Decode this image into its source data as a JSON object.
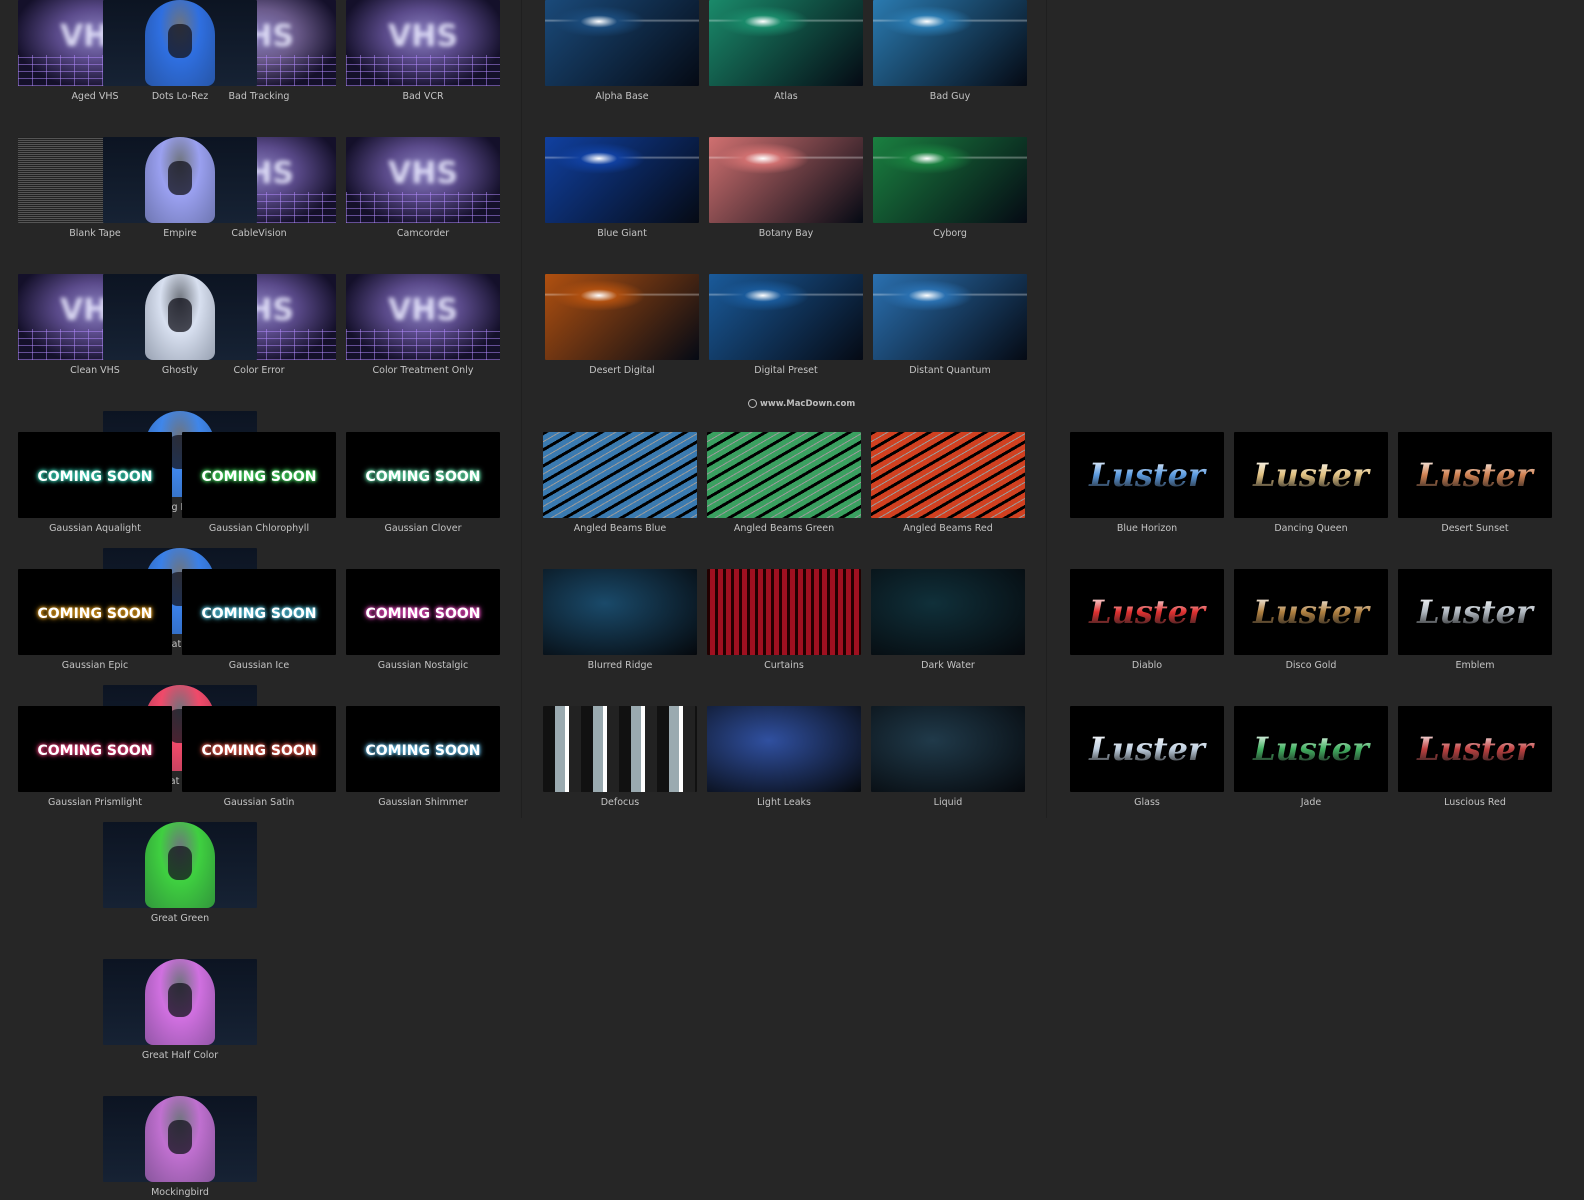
{
  "panels": [
    {
      "style": "vhs",
      "art_text": "VHS",
      "items": [
        {
          "label": "Aged VHS",
          "color": "#5a4a8a"
        },
        {
          "label": "Bad Tracking",
          "color": "#6a5a8a"
        },
        {
          "label": "Bad VCR",
          "color": "#5a4a8a"
        },
        {
          "label": "Blank Tape",
          "color": "#777777"
        },
        {
          "label": "CableVision",
          "color": "#5a4a8a"
        },
        {
          "label": "Camcorder",
          "color": "#5a4a8a"
        },
        {
          "label": "Clean VHS",
          "color": "#5a4a8a"
        },
        {
          "label": "Color Error",
          "color": "#5a4a8a"
        },
        {
          "label": "Color Treatment Only",
          "color": "#5a4a8a"
        }
      ]
    },
    {
      "style": "hood",
      "items": [
        {
          "label": "Dots Lo-Rez",
          "color": "#2f6fe0"
        },
        {
          "label": "Empire",
          "color": "#9aa0f0"
        },
        {
          "label": "Ghostly",
          "color": "#d8e0f0"
        },
        {
          "label": "Going Rogue",
          "color": "#3f86ea"
        },
        {
          "label": "Great Blue",
          "color": "#3a80e8"
        },
        {
          "label": "Great Color",
          "color": "#f04a6a"
        },
        {
          "label": "Great Green",
          "color": "#3fd040"
        },
        {
          "label": "Great Half Color",
          "color": "#d070e0"
        },
        {
          "label": "Mockingbird",
          "color": "#c070d0"
        }
      ]
    },
    {
      "style": "flare",
      "items": [
        {
          "label": "Alpha Base",
          "color": "#1a4a7a"
        },
        {
          "label": "Atlas",
          "color": "#1a8a6a"
        },
        {
          "label": "Bad Guy",
          "color": "#2a7ab0"
        },
        {
          "label": "Blue Giant",
          "color": "#1040a0"
        },
        {
          "label": "Botany Bay",
          "color": "#d07070"
        },
        {
          "label": "Cyborg",
          "color": "#1a8040"
        },
        {
          "label": "Desert Digital",
          "color": "#b05010"
        },
        {
          "label": "Digital Preset",
          "color": "#1a5a9a"
        },
        {
          "label": "Distant Quantum",
          "color": "#2a70b0"
        }
      ]
    },
    {
      "style": "soon",
      "art_text": "COMING SOON",
      "items": [
        {
          "label": "Gaussian Aqualight",
          "color": "#40f0d0"
        },
        {
          "label": "Gaussian Chlorophyll",
          "color": "#50ff70"
        },
        {
          "label": "Gaussian Clover",
          "color": "#70ffc0"
        },
        {
          "label": "Gaussian Epic",
          "color": "#ffb020"
        },
        {
          "label": "Gaussian Ice",
          "color": "#60e0ff"
        },
        {
          "label": "Gaussian Nostalgic",
          "color": "#ff50d0"
        },
        {
          "label": "Gaussian Prismlight",
          "color": "#ff4080"
        },
        {
          "label": "Gaussian Satin",
          "color": "#ff6050"
        },
        {
          "label": "Gaussian Shimmer",
          "color": "#70d0ff"
        }
      ]
    },
    {
      "style": "bg",
      "items": [
        {
          "label": "Angled Beams Blue",
          "color": "#3a7ab0"
        },
        {
          "label": "Angled Beams Green",
          "color": "#3aa060"
        },
        {
          "label": "Angled Beams Red",
          "color": "#d04020"
        },
        {
          "label": "Blurred Ridge",
          "color": "#1a4a6a"
        },
        {
          "label": "Curtains",
          "color": "#a01020"
        },
        {
          "label": "Dark Water",
          "color": "#10303a"
        },
        {
          "label": "Defocus",
          "color": "#9aaab0"
        },
        {
          "label": "Light Leaks",
          "color": "#3050a0"
        },
        {
          "label": "Liquid",
          "color": "#203a4a"
        }
      ]
    },
    {
      "style": "luster",
      "art_text": "Luster",
      "items": [
        {
          "label": "Blue Horizon",
          "color": "#5a9ae0"
        },
        {
          "label": "Dancing Queen",
          "color": "#e0c080"
        },
        {
          "label": "Desert Sunset",
          "color": "#d08050"
        },
        {
          "label": "Diablo",
          "color": "#e03030"
        },
        {
          "label": "Disco Gold",
          "color": "#b08040"
        },
        {
          "label": "Emblem",
          "color": "#b0b8c0"
        },
        {
          "label": "Glass",
          "color": "#c0d0e0"
        },
        {
          "label": "Jade",
          "color": "#40b060"
        },
        {
          "label": "Luscious Red",
          "color": "#c04040"
        }
      ]
    }
  ],
  "watermark": "www.MacDown.com"
}
